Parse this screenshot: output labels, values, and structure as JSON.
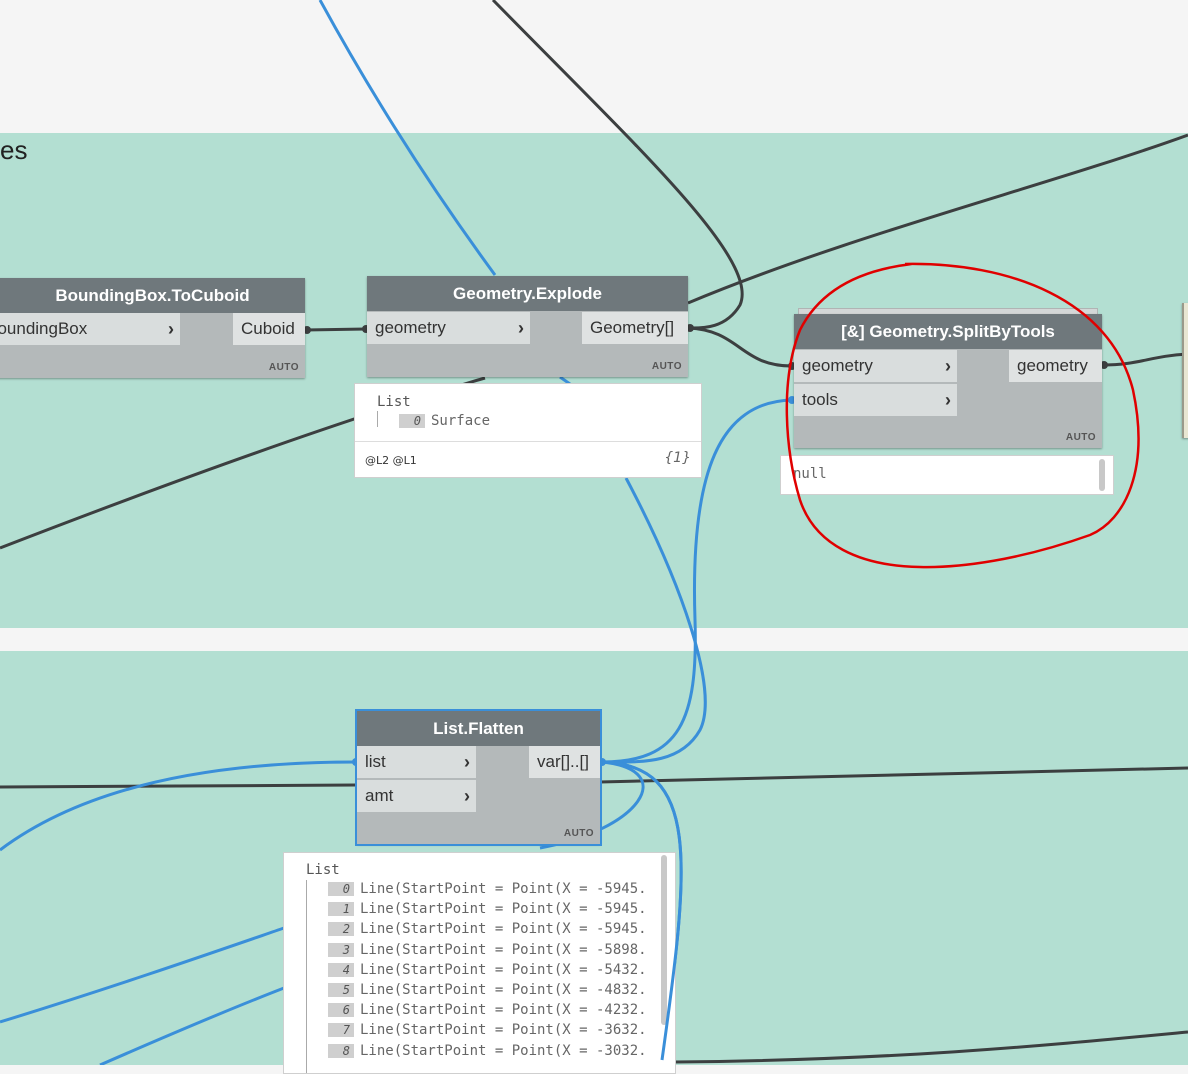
{
  "groups": [
    {
      "title": "es"
    },
    {
      "title": ""
    }
  ],
  "nodes": {
    "bbox_to_cuboid": {
      "title": "BoundingBox.ToCuboid",
      "input": "boundingBox",
      "output": "Cuboid",
      "lacing": "AUTO"
    },
    "explode": {
      "title": "Geometry.Explode",
      "input": "geometry",
      "output": "Geometry[]",
      "lacing": "AUTO",
      "preview": {
        "header": "List",
        "items": [
          {
            "index": "0",
            "value": "Surface"
          }
        ],
        "levels": "@L2 @L1",
        "count": "{1}"
      }
    },
    "split_by_tools": {
      "title": "[&] Geometry.SplitByTools",
      "inputs": [
        "geometry",
        "tools"
      ],
      "output": "geometry",
      "lacing": "AUTO",
      "preview": {
        "value": "null"
      }
    },
    "flatten": {
      "title": "List.Flatten",
      "inputs": [
        "list",
        "amt"
      ],
      "output": "var[]..[]",
      "lacing": "AUTO",
      "preview": {
        "header": "List",
        "items": [
          {
            "index": "0",
            "value": "Line(StartPoint = Point(X = -5945."
          },
          {
            "index": "1",
            "value": "Line(StartPoint = Point(X = -5945."
          },
          {
            "index": "2",
            "value": "Line(StartPoint = Point(X = -5945."
          },
          {
            "index": "3",
            "value": "Line(StartPoint = Point(X = -5898."
          },
          {
            "index": "4",
            "value": "Line(StartPoint = Point(X = -5432."
          },
          {
            "index": "5",
            "value": "Line(StartPoint = Point(X = -4832."
          },
          {
            "index": "6",
            "value": "Line(StartPoint = Point(X = -4232."
          },
          {
            "index": "7",
            "value": "Line(StartPoint = Point(X = -3632."
          },
          {
            "index": "8",
            "value": "Line(StartPoint = Point(X = -3032."
          }
        ]
      }
    }
  },
  "colors": {
    "canvas": "#f5f5f5",
    "group": "#b3dfd2",
    "node_header": "#6f787c",
    "wire_dark": "#3c3f40",
    "wire_selected": "#3a8fd9",
    "annotation": "#e00000"
  },
  "annotation": "red-freehand-circle"
}
